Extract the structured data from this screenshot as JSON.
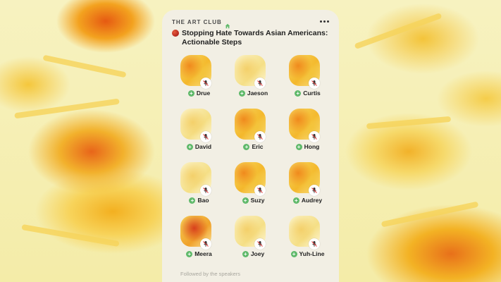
{
  "room": {
    "club_name": "THE ART CLUB",
    "title": "Stopping Hate Towards Asian Americans: Actionable Steps",
    "followed_label": "Followed by the speakers"
  },
  "speakers": [
    {
      "name": "Drue"
    },
    {
      "name": "Jaeson"
    },
    {
      "name": "Curtis"
    },
    {
      "name": "David"
    },
    {
      "name": "Eric"
    },
    {
      "name": "Hong"
    },
    {
      "name": "Bao"
    },
    {
      "name": "Suzy"
    },
    {
      "name": "Audrey"
    },
    {
      "name": "Meera"
    },
    {
      "name": "Joey"
    },
    {
      "name": "Yuh-Line"
    }
  ],
  "icons": {
    "club": "house-icon",
    "live": "red-dot-icon",
    "menu": "more-icon",
    "new_member": "plus-icon",
    "speaker_status": "microphone-icon"
  },
  "colors": {
    "card_background": "#f2efe4",
    "accent_green": "#5fb96a",
    "live_red": "#b3261e",
    "art_yellow": "#f6d35a",
    "art_orange": "#e65a12"
  }
}
